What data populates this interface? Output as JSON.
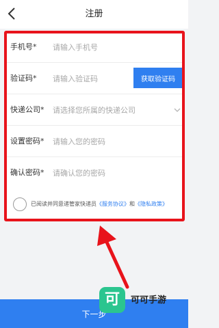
{
  "header": {
    "title": "注册",
    "back_icon": "chevron-left-icon"
  },
  "form": {
    "phone": {
      "label": "手机号*",
      "placeholder": "请输入手机号",
      "value": ""
    },
    "code": {
      "label": "验证码*",
      "placeholder": "请输入验证码",
      "value": "",
      "button": "获取验证码"
    },
    "courier": {
      "label": "快递公司*",
      "placeholder": "请选择您所属的快递公司",
      "icon": "chevron-down-icon"
    },
    "password": {
      "label": "设置密码*",
      "placeholder": "请输入您的密码",
      "value": ""
    },
    "confirm": {
      "label": "确认密码*",
      "placeholder": "请确认您的密码",
      "value": ""
    },
    "agreement": {
      "prefix": "已阅读并同意递管家快递员",
      "service_link": "《服务协议》",
      "and": "和",
      "privacy_link": "《隐私政策》",
      "checked": false
    }
  },
  "next_button": "下一步",
  "watermark": {
    "logo_char": "可",
    "text": "可可手游"
  },
  "colors": {
    "accent": "#2f7ff0",
    "highlight": "#e8131b",
    "watermark_logo": "#2bc58f"
  }
}
